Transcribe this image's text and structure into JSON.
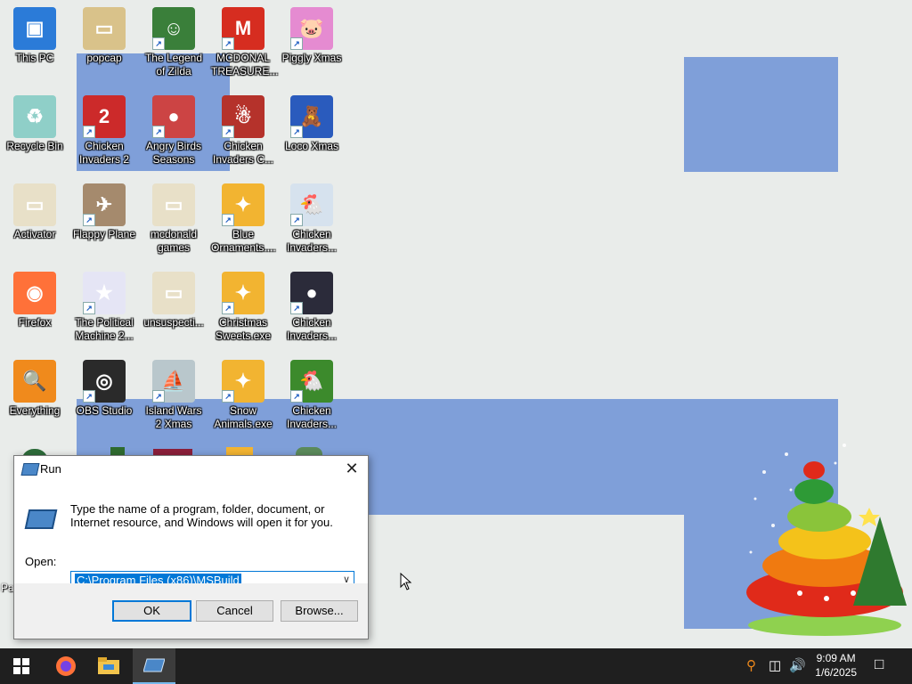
{
  "desktop_icons": [
    {
      "label": "This PC",
      "icon": "computer-icon",
      "color": "#2b7bd8",
      "glyph": "▣"
    },
    {
      "label": "popcap",
      "icon": "folder-icon",
      "color": "#d9c28a",
      "glyph": "▭"
    },
    {
      "label": "The Legend of Zilda",
      "icon": "zilda-game-icon",
      "color": "#3a7f3a",
      "glyph": "☺"
    },
    {
      "label": "MCDONAL TREASURE...",
      "icon": "mcdonald-icon",
      "color": "#d62d20",
      "glyph": "M"
    },
    {
      "label": "Piggly Xmas",
      "icon": "pig-icon",
      "color": "#e58bd1",
      "glyph": "🐷"
    },
    {
      "label": "Recycle Bin",
      "icon": "recycle-bin-icon",
      "color": "#8fcfc8",
      "glyph": "♻"
    },
    {
      "label": "Chicken Invaders 2",
      "icon": "chicken-invaders-icon",
      "color": "#cc2a2a",
      "glyph": "2"
    },
    {
      "label": "Angry Birds Seasons",
      "icon": "angry-birds-icon",
      "color": "#c44",
      "glyph": "●"
    },
    {
      "label": "Chicken Invaders C...",
      "icon": "chicken-invaders-icon",
      "color": "#b5322b",
      "glyph": "☃"
    },
    {
      "label": "Loco Xmas",
      "icon": "loco-xmas-icon",
      "color": "#2a5bbd",
      "glyph": "🧸"
    },
    {
      "label": "Activator",
      "icon": "folder-icon",
      "color": "#e8e0c8",
      "glyph": "▭"
    },
    {
      "label": "Flappy Plane",
      "icon": "flappy-plane-icon",
      "color": "#a58a6d",
      "glyph": "✈"
    },
    {
      "label": "mcdonald games",
      "icon": "folder-icon",
      "color": "#e8e0c8",
      "glyph": "▭"
    },
    {
      "label": "Blue Ornaments....",
      "icon": "ornaments-exe-icon",
      "color": "#f2b431",
      "glyph": "✦"
    },
    {
      "label": "Chicken Invaders...",
      "icon": "chicken-invaders-icon",
      "color": "#d6e2ee",
      "glyph": "🐔"
    },
    {
      "label": "Firefox",
      "icon": "firefox-icon",
      "color": "#ff7139",
      "glyph": "◉"
    },
    {
      "label": "The Political Machine 2...",
      "icon": "political-machine-icon",
      "color": "#e5e5f5",
      "glyph": "★"
    },
    {
      "label": "unsuspecti...",
      "icon": "folder-icon",
      "color": "#e8e0c8",
      "glyph": "▭"
    },
    {
      "label": "Christmas Sweets.exe",
      "icon": "sweets-exe-icon",
      "color": "#f2b431",
      "glyph": "✦"
    },
    {
      "label": "Chicken Invaders...",
      "icon": "chicken-invaders-icon",
      "color": "#2b2b3a",
      "glyph": "●"
    },
    {
      "label": "Everything",
      "icon": "everything-search-icon",
      "color": "#f08a1c",
      "glyph": "🔍"
    },
    {
      "label": "OBS Studio",
      "icon": "obs-icon",
      "color": "#2a2a2a",
      "glyph": "◎"
    },
    {
      "label": "Island Wars 2 Xmas",
      "icon": "island-wars-icon",
      "color": "#b9c7cc",
      "glyph": "⛵"
    },
    {
      "label": "Snow Animals.exe",
      "icon": "snow-animals-exe-icon",
      "color": "#f2b431",
      "glyph": "✦"
    },
    {
      "label": "Chicken Invaders...",
      "icon": "chicken-invaders-icon",
      "color": "#3c8a2c",
      "glyph": "🐔"
    }
  ],
  "run_dialog": {
    "title": "Run",
    "description": "Type the name of a program, folder, document, or Internet resource, and Windows will open it for you.",
    "open_label": "Open:",
    "open_value": "C:\\Program Files (x86)\\MSBuild",
    "ok_label": "OK",
    "cancel_label": "Cancel",
    "browse_label": "Browse...",
    "close_glyph": "✕"
  },
  "taskbar": {
    "time": "9:09 AM",
    "date": "1/6/2025",
    "accent": "#76b9ed"
  },
  "partial_label": "Pa"
}
